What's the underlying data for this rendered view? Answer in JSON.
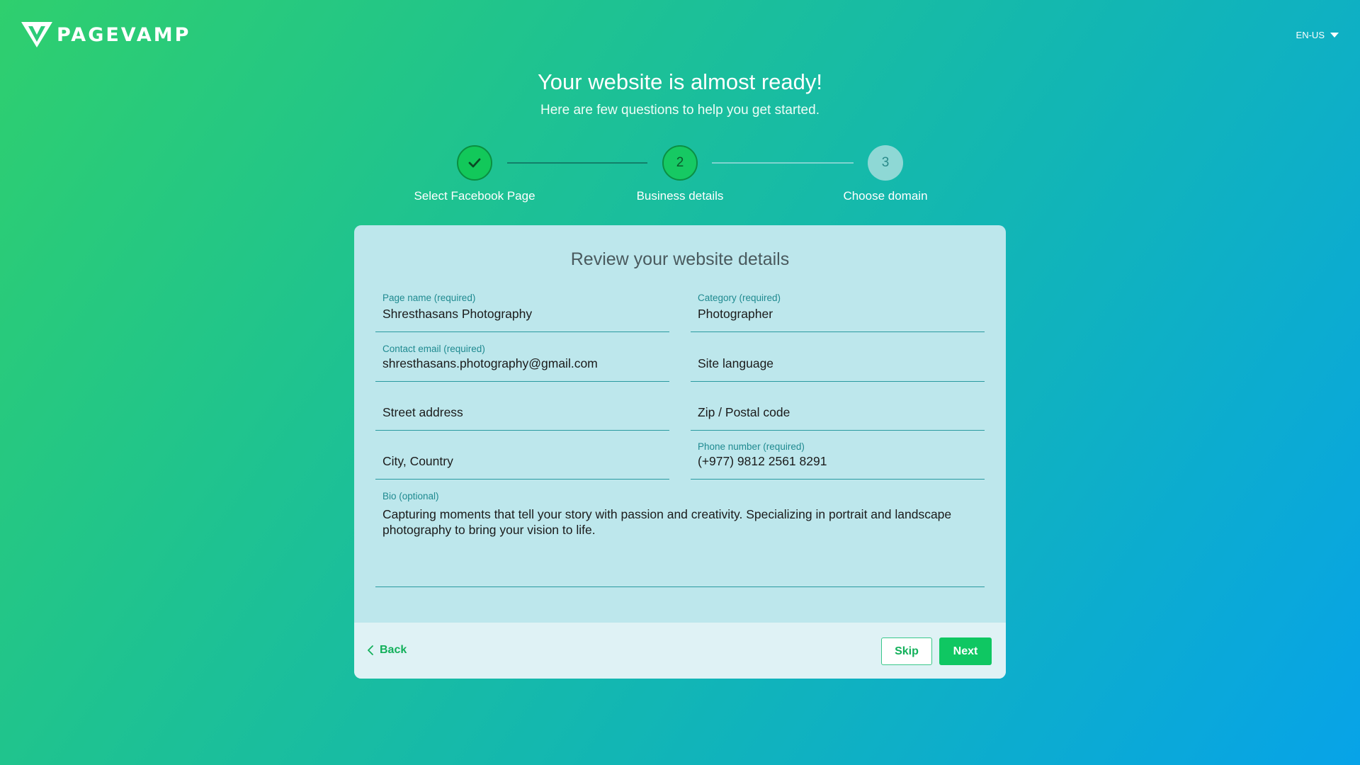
{
  "header": {
    "logo_text": "PAGEVAMP",
    "language": "EN-US"
  },
  "intro": {
    "title": "Your website is almost ready!",
    "subtitle": "Here are few questions to help you get started."
  },
  "stepper": {
    "steps": [
      {
        "label": "Select Facebook Page",
        "marker": "",
        "state": "done"
      },
      {
        "label": "Business details",
        "marker": "2",
        "state": "active"
      },
      {
        "label": "Choose domain",
        "marker": "3",
        "state": "pending"
      }
    ]
  },
  "form": {
    "title": "Review your website details",
    "page_name": {
      "label": "Page name (required)",
      "value": "Shresthasans Photography"
    },
    "category": {
      "label": "Category (required)",
      "value": "Photographer"
    },
    "contact_email": {
      "label": "Contact email (required)",
      "value": "shresthasans.photography@gmail.com"
    },
    "site_language": {
      "placeholder": "Site language"
    },
    "street_address": {
      "placeholder": "Street address"
    },
    "zip_code": {
      "placeholder": "Zip / Postal code"
    },
    "city_country": {
      "placeholder": "City, Country"
    },
    "phone_number": {
      "label": "Phone number (required)",
      "value": "(+977) 9812 2561 8291"
    },
    "bio": {
      "label": "Bio (optional)",
      "value": "Capturing moments that tell your story with passion and creativity. Specializing in portrait and landscape photography to bring your vision to life."
    }
  },
  "footer": {
    "back_label": "Back",
    "skip_label": "Skip",
    "next_label": "Next"
  },
  "colors": {
    "accent_green": "#0fc762",
    "field_underline": "#2a9aa0",
    "card_background": "#bde7ec"
  }
}
